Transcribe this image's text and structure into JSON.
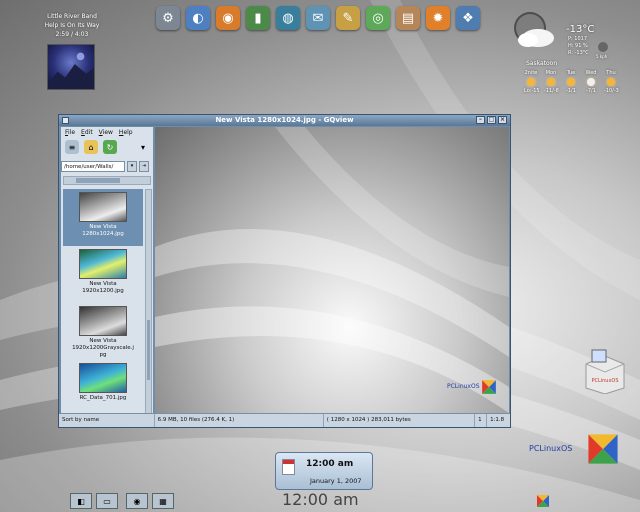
{
  "music": {
    "artist": "Little River Band",
    "track": "Help Is On Its Way",
    "time": "2:59 / 4:03"
  },
  "dock": [
    {
      "icon": "gear-icon",
      "color": "#7d8794",
      "glyph": "⚙"
    },
    {
      "icon": "disc-icon",
      "color": "#4e7fc0",
      "glyph": "◐"
    },
    {
      "icon": "fire-disc-icon",
      "color": "#d87b2a",
      "glyph": "◉"
    },
    {
      "icon": "book-icon",
      "color": "#4d8a4a",
      "glyph": "▮"
    },
    {
      "icon": "globe-icon",
      "color": "#3a7e9e",
      "glyph": "◍"
    },
    {
      "icon": "mail-icon",
      "color": "#5f93b3",
      "glyph": "✉"
    },
    {
      "icon": "paint-icon",
      "color": "#c7a045",
      "glyph": "✎"
    },
    {
      "icon": "spiral-icon",
      "color": "#5ea85a",
      "glyph": "◎"
    },
    {
      "icon": "notes-icon",
      "color": "#b5865a",
      "glyph": "▤"
    },
    {
      "icon": "fire-icon",
      "color": "#e0802b",
      "glyph": "✹"
    },
    {
      "icon": "film-icon",
      "color": "#4f7db0",
      "glyph": "❖"
    }
  ],
  "weather": {
    "temp": "-13°C",
    "pressure": "P: 1017",
    "humidity": "H: 91 %",
    "realfeel": "R: -13°C",
    "wind": "5 kph",
    "city": "Saskatoon",
    "days": [
      {
        "name": "2nite",
        "range": "Lo:-15"
      },
      {
        "name": "Mon",
        "range": "-11/-8"
      },
      {
        "name": "Tue",
        "range": "-1/1"
      },
      {
        "name": "Wed",
        "range": "-7/1"
      },
      {
        "name": "Thu",
        "range": "-10/-3"
      }
    ]
  },
  "window": {
    "title": "New Vista 1280x1024.jpg - GQview",
    "menu": [
      "File",
      "Edit",
      "View",
      "Help"
    ],
    "path": "/home/user/Walls/",
    "thumbnails": [
      {
        "label": "New Vista\n1280x1024.jpg",
        "selected": true
      },
      {
        "label": "New Vista\n1920x1200.jpg",
        "selected": false
      },
      {
        "label": "New Vista\n1920x1200Grayscale.j\npg",
        "selected": false
      },
      {
        "label": "RC_Data_701.jpg",
        "selected": false
      }
    ],
    "status": {
      "sort": "Sort by name",
      "summary": "6.9 MB, 10 files (276.4 K, 1)",
      "image_info": "( 1280 x 1024 ) 283,011 bytes",
      "index": "1",
      "zoom": "1:1.8"
    },
    "preview_brand": "PCLinuxOS"
  },
  "clock": {
    "time": "12:00 am",
    "date": "January 1, 2007",
    "big_time": "12:00 am"
  },
  "desktop": {
    "brand": "PCLinuxOS",
    "package_label": "PCLinuxOS"
  }
}
